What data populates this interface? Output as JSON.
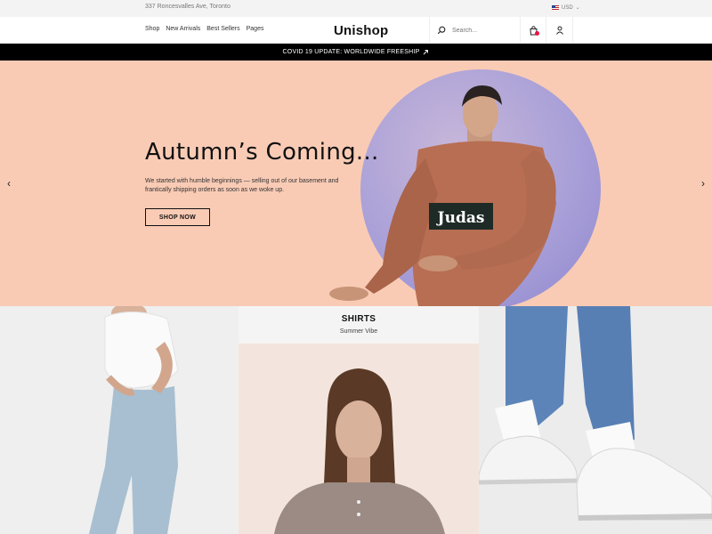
{
  "topbar": {
    "address": "337 Roncesvalles Ave, Toronto",
    "currency": "USD"
  },
  "nav": {
    "links": [
      "Shop",
      "New Arrivals",
      "Best Sellers",
      "Pages"
    ],
    "logo": "Unishop",
    "search_placeholder": "Search..."
  },
  "announcement": {
    "text": "COVID 19 UPDATE: WORLDWIDE FREESHIP"
  },
  "hero": {
    "title": "Autumn’s Coming...",
    "description": "We started with humble beginnings — selling out of our basement and frantically shipping orders as soon as we woke up.",
    "button": "SHOP NOW",
    "shirt_text": "Judas",
    "background": "#f9cbb5"
  },
  "tiles": [
    {
      "title": "SHIRTS",
      "subtitle": "Summer Vibe"
    }
  ],
  "colors": {
    "accent": "#111111",
    "badge": "#ee1144",
    "announcement_bg": "#000000"
  }
}
